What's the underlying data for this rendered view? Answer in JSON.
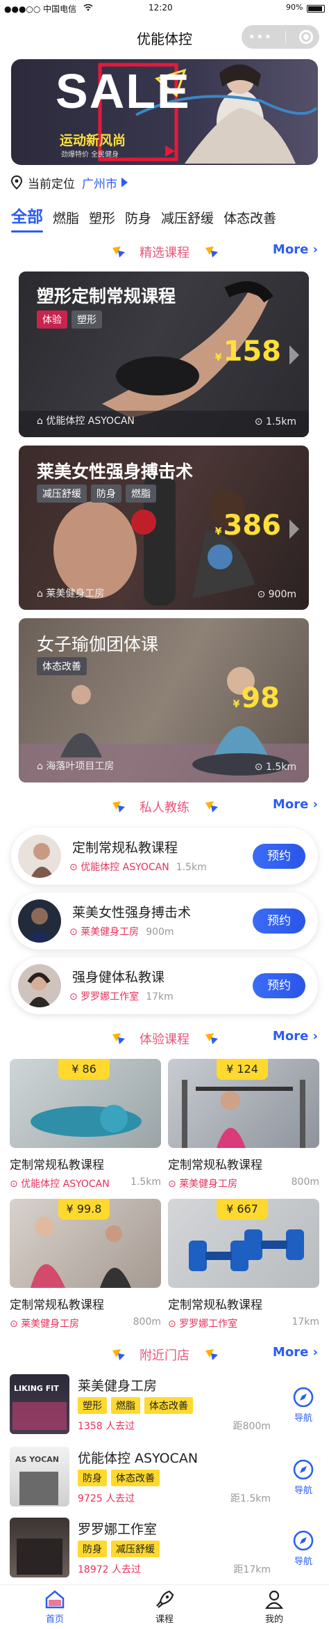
{
  "status": {
    "carrier": "●●●○○ 中国电信",
    "wifi_icon": "wifi-icon",
    "time": "12:20",
    "battery": "90%"
  },
  "title": "优能体控",
  "banner": {
    "sale": "SALE",
    "slogan": "运动新风尚",
    "sub": "劲爆特价 全民健身"
  },
  "location": {
    "label": "当前定位",
    "city": "广州市"
  },
  "categories": [
    "全部",
    "燃脂",
    "塑形",
    "防身",
    "减压舒缓",
    "体态改善"
  ],
  "sections": {
    "featured": "精选课程",
    "coach": "私人教练",
    "trial": "体验课程",
    "nearby": "附近门店",
    "more": "More"
  },
  "featured": [
    {
      "title": "塑形定制常规课程",
      "tags": [
        "体验",
        "塑形"
      ],
      "currency": "¥",
      "price": "158",
      "venue": "优能体控 ASYOCAN",
      "distance": "1.5km"
    },
    {
      "title": "莱美女性强身搏击术",
      "tags": [
        "减压舒缓",
        "防身",
        "燃脂"
      ],
      "currency": "¥",
      "price": "386",
      "venue": "莱美健身工房",
      "distance": "900m"
    },
    {
      "title": "女子瑜伽团体课",
      "tags": [
        "体态改善"
      ],
      "currency": "¥",
      "price": "98",
      "venue": "海落叶项目工房",
      "distance": "1.5km"
    }
  ],
  "coaches": [
    {
      "name": "定制常规私教课程",
      "venue": "优能体控 ASYOCAN",
      "distance": "1.5km",
      "button": "预约"
    },
    {
      "name": "莱美女性强身搏击术",
      "venue": "莱美健身工房",
      "distance": "900m",
      "button": "预约"
    },
    {
      "name": "强身健体私教课",
      "venue": "罗罗娜工作室",
      "distance": "17km",
      "button": "预约"
    }
  ],
  "trials": [
    {
      "price": "¥ 86",
      "name": "定制常规私教课程",
      "venue": "优能体控 ASYOCAN",
      "distance": "1.5km"
    },
    {
      "price": "¥ 124",
      "name": "定制常规私教课程",
      "venue": "莱美健身工房",
      "distance": "800m"
    },
    {
      "price": "¥ 99.8",
      "name": "定制常规私教课程",
      "venue": "莱美健身工房",
      "distance": "800m"
    },
    {
      "price": "¥ 667",
      "name": "定制常规私教课程",
      "venue": "罗罗娜工作室",
      "distance": "17km"
    }
  ],
  "stores": [
    {
      "name": "莱美健身工房",
      "tags": [
        "塑形",
        "燃脂",
        "体态改善"
      ],
      "count": "1358 人去过",
      "distance": "距800m",
      "nav": "导航",
      "sign": "LIKING FIT"
    },
    {
      "name": "优能体控 ASYOCAN",
      "tags": [
        "防身",
        "体态改善"
      ],
      "count": "9725 人去过",
      "distance": "距1.5km",
      "nav": "导航",
      "sign": "AS YOCAN"
    },
    {
      "name": "罗罗娜工作室",
      "tags": [
        "防身",
        "减压舒缓"
      ],
      "count": "18972 人去过",
      "distance": "距17km",
      "nav": "导航",
      "sign": ""
    }
  ],
  "tabs": [
    "首页",
    "课程",
    "我的"
  ],
  "colors": {
    "accent": "#2b5cf5",
    "pink": "#e8305a",
    "yellow": "#ffd92e",
    "price": "#ffe03a"
  }
}
